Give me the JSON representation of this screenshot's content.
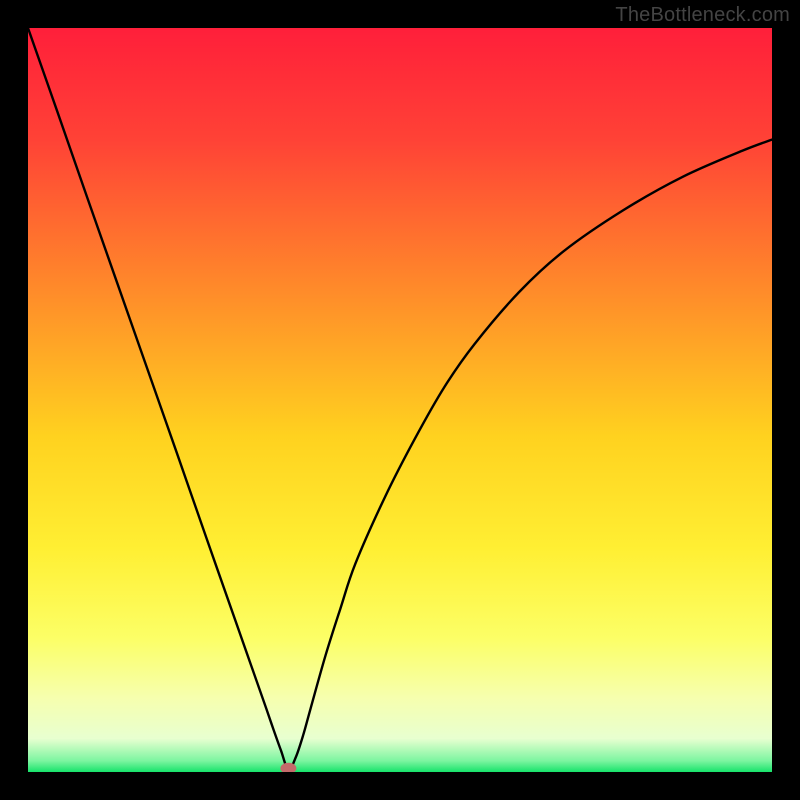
{
  "watermark": "TheBottleneck.com",
  "chart_data": {
    "type": "line",
    "title": "",
    "xlabel": "",
    "ylabel": "",
    "xlim": [
      0,
      100
    ],
    "ylim": [
      0,
      100
    ],
    "curve": {
      "x": [
        0,
        4,
        8,
        12,
        16,
        20,
        24,
        28,
        30,
        32,
        33,
        34,
        35,
        36,
        37,
        38,
        40,
        42,
        44,
        48,
        52,
        56,
        60,
        66,
        72,
        80,
        88,
        96,
        100
      ],
      "y": [
        100,
        88.6,
        77.1,
        65.7,
        54.3,
        42.9,
        31.4,
        20,
        14.3,
        8.6,
        5.7,
        2.9,
        0.3,
        2,
        5,
        8.6,
        15.7,
        22,
        28,
        37,
        44.8,
        51.8,
        57.5,
        64.5,
        70,
        75.5,
        80,
        83.5,
        85
      ]
    },
    "marker": {
      "x": 35,
      "y": 0.5,
      "color": "#c46a6a"
    },
    "gradient_stops": [
      {
        "offset": 0.0,
        "color": "#ff1f3a"
      },
      {
        "offset": 0.15,
        "color": "#ff4236"
      },
      {
        "offset": 0.35,
        "color": "#ff8a2a"
      },
      {
        "offset": 0.55,
        "color": "#ffd21f"
      },
      {
        "offset": 0.7,
        "color": "#ffef33"
      },
      {
        "offset": 0.82,
        "color": "#fcff66"
      },
      {
        "offset": 0.9,
        "color": "#f6ffae"
      },
      {
        "offset": 0.955,
        "color": "#e8ffd0"
      },
      {
        "offset": 0.985,
        "color": "#7cf5a0"
      },
      {
        "offset": 1.0,
        "color": "#17e36b"
      }
    ]
  }
}
